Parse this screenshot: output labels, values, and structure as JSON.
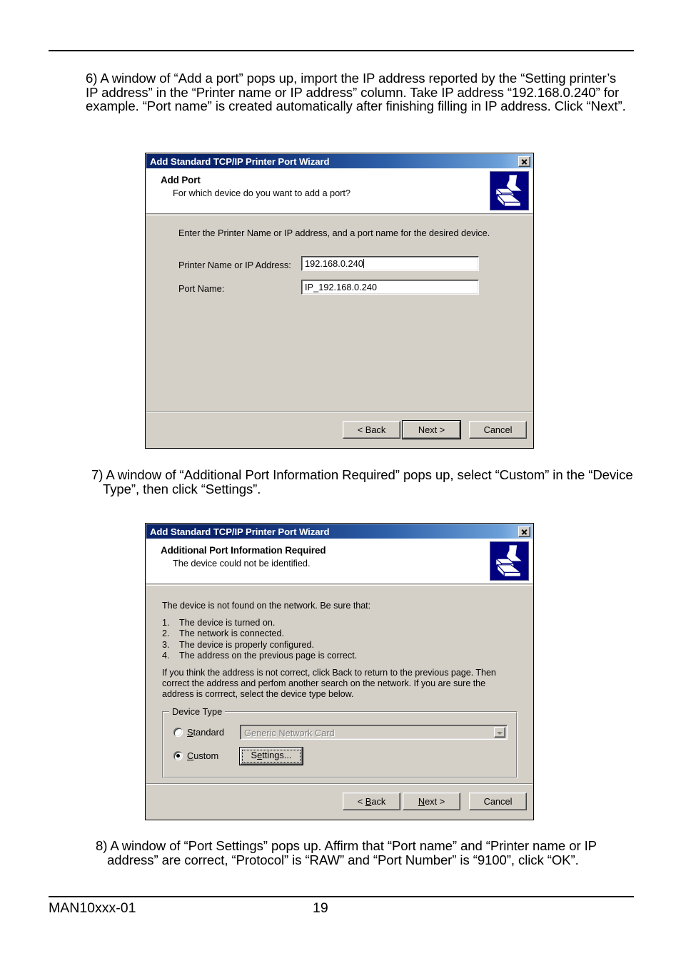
{
  "document": {
    "footer_code": "MAN10xxx-01",
    "page_number": "19"
  },
  "steps": {
    "step6": "6) A window of “Add a port” pops up, import the IP address reported by the “Setting printer’s IP address” in the “Printer name or IP address” column. Take IP address “192.168.0.240” for example. “Port name” is created automatically after finishing filling in IP address. Click “Next”.",
    "step7": "7) A window of “Additional Port Information Required” pops up, select “Custom” in the “Device Type”, then click “Settings”.",
    "step8": "8) A window of “Port Settings” pops up. Affirm that “Port name” and “Printer name or IP address” are correct, “Protocol” is “RAW” and “Port Number” is “9100”, click “OK”."
  },
  "colors": {
    "titlebar_start": "#0a246a",
    "titlebar_end": "#a6caf0",
    "dialog_face": "#d4d0c8",
    "icon_background": "#000080"
  },
  "dialog_add_port": {
    "title": "Add Standard TCP/IP Printer Port Wizard",
    "close_icon": "close-icon",
    "header_title": "Add Port",
    "header_subtitle": "For which device do you want to add a port?",
    "icon_name": "printer-icon",
    "intro": "Enter the Printer Name or IP address, and a port name for the desired device.",
    "fields": [
      {
        "label": "Printer Name or IP Address:",
        "value": "192.168.0.240"
      },
      {
        "label": "Port Name:",
        "value": "IP_192.168.0.240"
      }
    ],
    "buttons": {
      "back": "< Back",
      "next": "Next >",
      "cancel": "Cancel"
    }
  },
  "dialog_additional_info": {
    "title": "Add Standard TCP/IP Printer Port Wizard",
    "close_icon": "close-icon",
    "header_title": "Additional Port Information Required",
    "header_subtitle": "The device could not be identified.",
    "icon_name": "printer-icon",
    "intro": "The device is not found on the network.  Be sure that:",
    "checklist": [
      {
        "num": "1.",
        "text": "The device is turned on."
      },
      {
        "num": "2.",
        "text": "The network is connected."
      },
      {
        "num": "3.",
        "text": "The device is properly configured."
      },
      {
        "num": "4.",
        "text": "The address on the previous page is correct."
      }
    ],
    "advice": "If you think the address is not correct, click Back to return to the previous page.  Then correct the address and perfom another search on the network.  If you are sure the address is corrrect, select the device type below.",
    "group": {
      "legend": "Device Type",
      "standard_label": "Standard",
      "standard_accel": "S",
      "standard_selected": false,
      "standard_combo_value": "Generic Network Card",
      "standard_combo_enabled": false,
      "custom_label": "Custom",
      "custom_accel": "C",
      "custom_selected": true,
      "settings_label": "Settings...",
      "settings_accel": "e"
    },
    "buttons": {
      "back": "< Back",
      "back_accel": "B",
      "next": "Next >",
      "next_accel": "N",
      "cancel": "Cancel"
    }
  }
}
